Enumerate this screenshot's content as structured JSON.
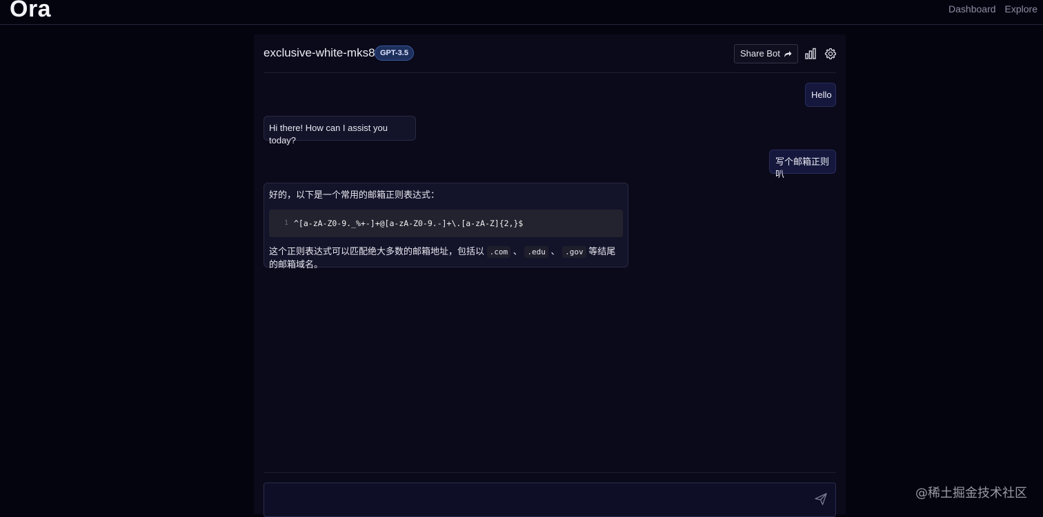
{
  "app": {
    "logo": "Ora",
    "nav": [
      "Dashboard",
      "Explore"
    ]
  },
  "header": {
    "bot_name": "exclusive-white-mks8",
    "model_badge": "GPT-3.5",
    "share_label": "Share Bot",
    "icons": [
      "share-arrow-icon",
      "bar-chart-icon",
      "gear-icon"
    ]
  },
  "messages": [
    {
      "role": "user",
      "text": "Hello"
    },
    {
      "role": "bot",
      "text": "Hi there! How can I assist you today?"
    },
    {
      "role": "user",
      "text": "写个邮箱正则叭"
    },
    {
      "role": "bot",
      "intro": "好的，以下是一个常用的邮箱正则表达式：",
      "code_line_number": "1",
      "code": "^[a-zA-Z0-9._%+-]+@[a-zA-Z0-9.-]+\\.[a-zA-Z]{2,}$",
      "outro_before": "这个正则表达式可以匹配绝大多数的邮箱地址，包括以",
      "code_com": ".com",
      "sep1": "、",
      "code_edu": ".edu",
      "sep2": "、",
      "code_gov": ".gov",
      "outro_after": "等结尾的邮箱域名。"
    }
  ],
  "composer": {
    "placeholder": "",
    "send_icon": "send-icon"
  },
  "watermark": "@稀土掘金技术社区"
}
